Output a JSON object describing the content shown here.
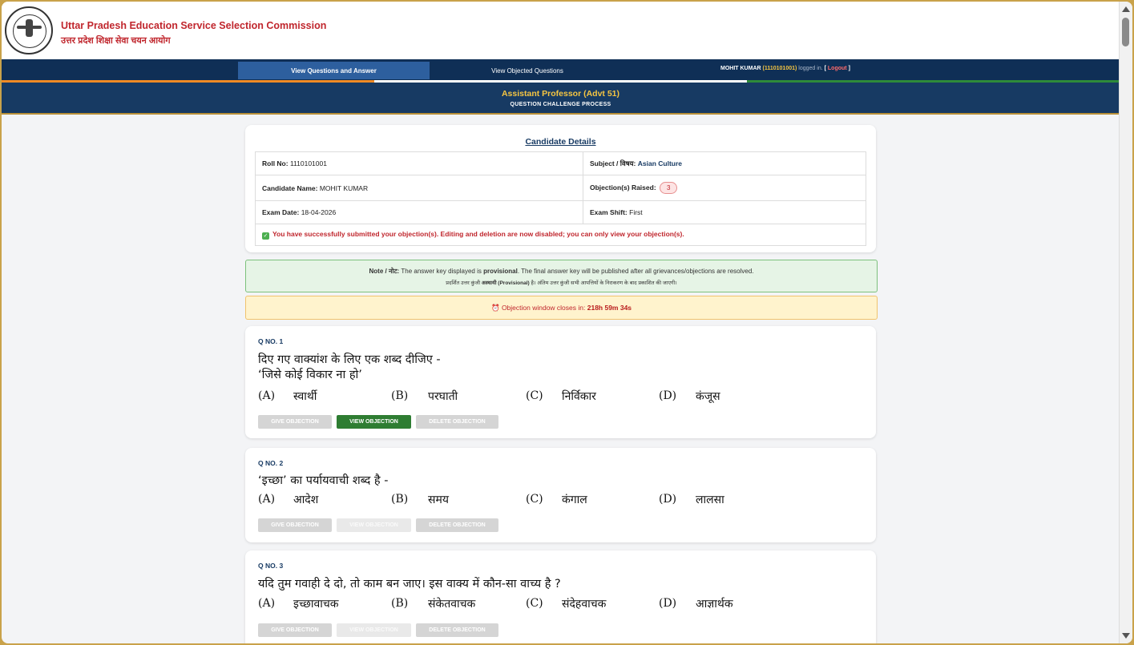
{
  "header": {
    "org_name_en": "Uttar Pradesh Education Service Selection Commission",
    "org_name_hi": "उत्तर प्रदेश शिक्षा सेवा चयन आयोग"
  },
  "nav": {
    "tab_view_questions": "View Questions and Answer",
    "tab_view_objected": "View Objected Questions",
    "user_name": "MOHIT KUMAR",
    "user_id": "(1110101001)",
    "logged_in_text": "logged in.",
    "logout_open": "[",
    "logout_label": "Logout",
    "logout_close": "]"
  },
  "banner": {
    "title": "Assistant Professor (Advt 51)",
    "subtitle": "QUESTION CHALLENGE PROCESS"
  },
  "candidate": {
    "heading": "Candidate Details",
    "roll_label": "Roll No:",
    "roll_value": "1110101001",
    "subject_label": "Subject / विषय:",
    "subject_value": "Asian Culture",
    "name_label": "Candidate Name:",
    "name_value": "MOHIT KUMAR",
    "objections_label": "Objection(s) Raised:",
    "objections_count": "3",
    "exam_date_label": "Exam Date:",
    "exam_date_value": "18-04-2026",
    "exam_shift_label": "Exam Shift:",
    "exam_shift_value": "First",
    "success_message": "You have successfully submitted your objection(s). Editing and deletion are now disabled; you can only view your objection(s)."
  },
  "note": {
    "label": "Note / नोट:",
    "en_pre": "The answer key displayed is",
    "en_bold": "provisional",
    "en_post": ". The final answer key will be published after all grievances/objections are resolved.",
    "hi_pre": "प्रदर्शित उत्तर कुंजी",
    "hi_bold": "अस्थायी (Provisional)",
    "hi_post": "है। अंतिम उत्तर कुंजी सभी आपत्तियों के निराकरण के बाद प्रकाशित की जाएगी।"
  },
  "timer": {
    "icon": "⏰",
    "label": "Objection window closes in:",
    "value": "218h 59m 34s"
  },
  "buttons": {
    "give": "GIVE OBJECTION",
    "view": "VIEW OBJECTION",
    "delete": "DELETE OBJECTION"
  },
  "questions": [
    {
      "no": "Q NO. 1",
      "line1": "दिए गए वाक्यांश के लिए एक शब्द दीजिए -",
      "line2": "‘जिसे कोई विकार ना हो’",
      "options": [
        {
          "key": "(A)",
          "text": "स्वार्थी"
        },
        {
          "key": "(B)",
          "text": "परघाती"
        },
        {
          "key": "(C)",
          "text": "निर्विकार"
        },
        {
          "key": "(D)",
          "text": "कंजूस"
        }
      ]
    },
    {
      "no": "Q NO. 2",
      "line1": "‘इच्छा’ का पर्यायवाची शब्द है -",
      "options": [
        {
          "key": "(A)",
          "text": "आदेश"
        },
        {
          "key": "(B)",
          "text": "समय"
        },
        {
          "key": "(C)",
          "text": "कंगाल"
        },
        {
          "key": "(D)",
          "text": "लालसा"
        }
      ]
    },
    {
      "no": "Q NO. 3",
      "line1": "यदि तुम गवाही दे दो, तो काम बन जाए। इस वाक्य में कौन-सा वाच्य है ?",
      "options": [
        {
          "key": "(A)",
          "text": "इच्छावाचक"
        },
        {
          "key": "(B)",
          "text": "संकेतवाचक"
        },
        {
          "key": "(C)",
          "text": "संदेहवाचक"
        },
        {
          "key": "(D)",
          "text": "आज्ञार्थक"
        }
      ]
    }
  ],
  "colors": {
    "brand_red": "#c0262d",
    "nav_navy": "#0f2f56",
    "accent_gold": "#f5c542",
    "success_green": "#2e7d32"
  }
}
